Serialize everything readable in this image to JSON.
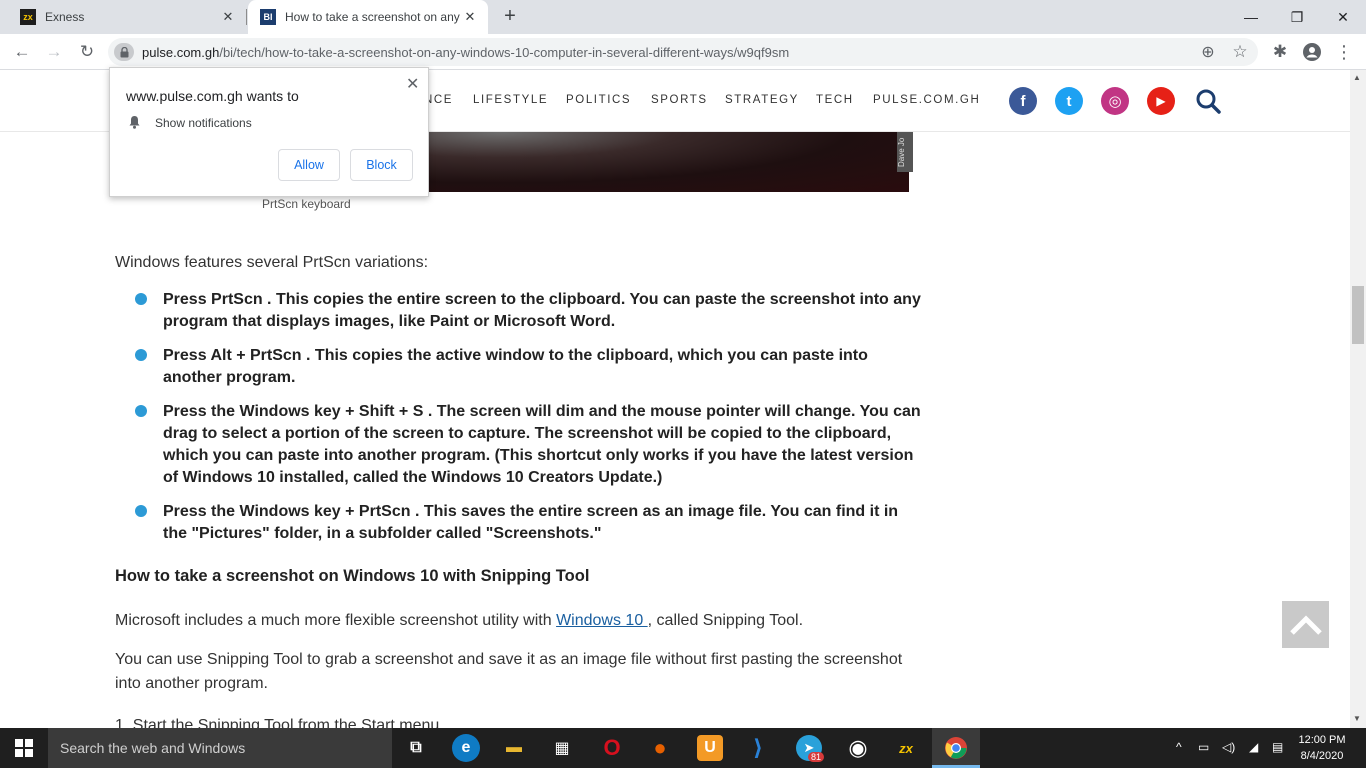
{
  "browser": {
    "tabs": [
      {
        "title": "Exness",
        "favicon": "exness-icon"
      },
      {
        "title": "How to take a screenshot on any",
        "favicon": "business-insider-icon",
        "favicon_text": "BI"
      }
    ],
    "new_tab": "+",
    "window_controls": {
      "minimize": "—",
      "restore": "❐",
      "close": "✕"
    },
    "url_host": "pulse.com.gh",
    "url_path": "/bi/tech/how-to-take-a-screenshot-on-any-windows-10-computer-in-several-different-ways/w9qf9sm"
  },
  "site_nav": {
    "items": [
      "NCE",
      "LIFESTYLE",
      "POLITICS",
      "SPORTS",
      "STRATEGY",
      "TECH",
      "PULSE.COM.GH"
    ],
    "social": [
      {
        "name": "facebook-icon",
        "glyph": "f",
        "color": "#3b5998"
      },
      {
        "name": "twitter-icon",
        "glyph": "t",
        "color": "#1da1f2"
      },
      {
        "name": "instagram-icon",
        "glyph": "◎",
        "color": "#c13584"
      },
      {
        "name": "youtube-icon",
        "glyph": "▶",
        "color": "#e62117"
      }
    ],
    "search_glyph": "⌕"
  },
  "article": {
    "hero_credit": "Dave Jo",
    "caption": "PrtScn keyboard",
    "intro": "Windows features several PrtScn variations:",
    "bullets": [
      "Press PrtScn . This copies the entire screen to the clipboard. You can paste the screenshot into any program that displays images, like Paint or Microsoft Word.",
      "Press Alt + PrtScn . This copies the active window to the clipboard, which you can paste into another program.",
      "Press the Windows key + Shift + S . The screen will dim and the mouse pointer will change. You can drag to select a portion of the screen to capture. The screenshot will be copied to the clipboard, which you can paste into another program. (This shortcut only works if you have the latest version of Windows 10 installed, called the Windows 10 Creators Update.)",
      "Press the Windows key + PrtScn . This saves the entire screen as an image file. You can find it in the \"Pictures\" folder, in a subfolder called \"Screenshots.\""
    ],
    "heading": "How to take a screenshot on Windows 10 with Snipping Tool",
    "para1_before": "Microsoft includes a much more flexible screenshot utility with ",
    "para1_link": "Windows 10 ",
    "para1_after": ", called Snipping Tool.",
    "para2": "You can use Snipping Tool to grab a screenshot and save it as an image file without first pasting the screenshot into another program.",
    "step1": "1. Start the Snipping Tool from the Start menu."
  },
  "notification": {
    "title": "www.pulse.com.gh wants to",
    "text": "Show notifications",
    "allow": "Allow",
    "block": "Block"
  },
  "taskbar": {
    "search_placeholder": "Search the web and Windows",
    "apps": [
      {
        "name": "task-view-icon",
        "glyph": "⧉",
        "color": "#1f1f1f"
      },
      {
        "name": "edge-icon",
        "glyph": "e",
        "color": "#0f7bc4"
      },
      {
        "name": "file-explorer-icon",
        "glyph": "▬",
        "color": "#e8b730"
      },
      {
        "name": "store-icon",
        "glyph": "▦",
        "color": "#1f1f1f"
      },
      {
        "name": "opera-icon",
        "glyph": "O",
        "color": "#d6101e"
      },
      {
        "name": "firefox-icon",
        "glyph": "●",
        "color": "#e66000"
      },
      {
        "name": "uc-browser-icon",
        "glyph": "U",
        "color": "#f39a26"
      },
      {
        "name": "vscode-icon",
        "glyph": "⟩",
        "color": "#2a82d8"
      },
      {
        "name": "telegram-icon",
        "glyph": "➤",
        "color": "#2aa1da"
      },
      {
        "name": "obs-icon",
        "glyph": "◉",
        "color": "#1f1f1f"
      },
      {
        "name": "exness-taskbar-icon",
        "glyph": "zx",
        "color": "#1f1f1f"
      },
      {
        "name": "chrome-icon",
        "glyph": "◎",
        "color": "#3c3c3c"
      }
    ],
    "telegram_badge": "81",
    "time": "12:00 PM",
    "date": "8/4/2020"
  }
}
